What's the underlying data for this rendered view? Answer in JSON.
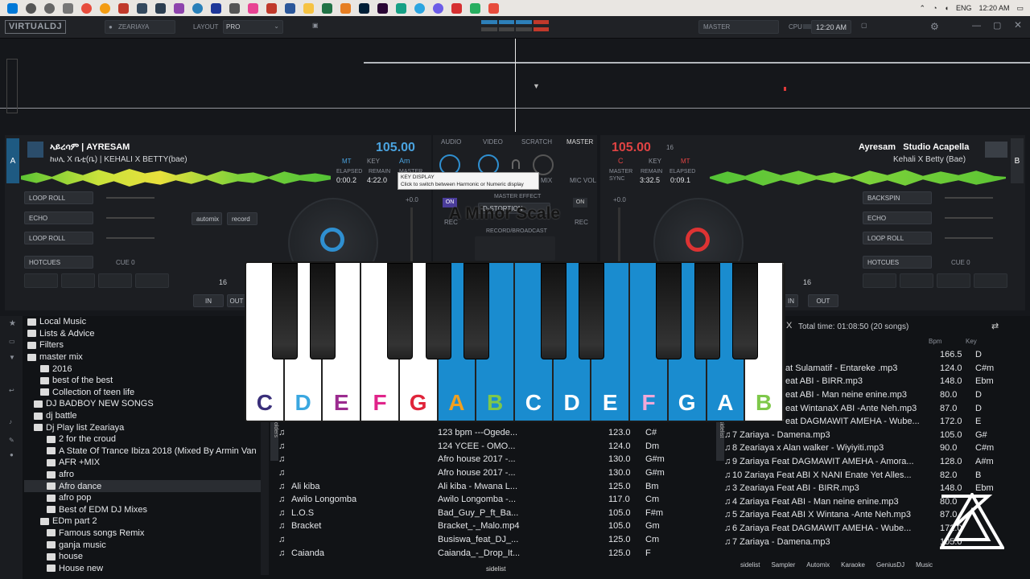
{
  "taskbar": {
    "time": "12:20 AM",
    "lang": "ENG"
  },
  "topbar": {
    "logo": "VIRTUALDJ",
    "user": "ZEARIAYA",
    "layout_label": "LAYOUT",
    "layout_value": "PRO",
    "master": "MASTER",
    "cpu": "CPU",
    "clock": "12:20 AM"
  },
  "deck_left": {
    "title": "ኣይረሳም | AYRESAM",
    "subtitle": "ከሀሊ X ቤቲ(ቤ) | KEHALI X BETTY(bae)",
    "bpm": "105.00",
    "key_label": "KEY",
    "key": "Am",
    "elapsed_label": "ELAPSED",
    "remain_label": "REMAIN",
    "elapsed": "0:00.2",
    "remain": "4:22.0",
    "master_label": "MASTER",
    "letter": "A",
    "pitch": "+0.0",
    "fx": [
      "LOOP ROLL",
      "ECHO",
      "LOOP ROLL"
    ],
    "hotcues": "HOTCUES",
    "cue": "CUE 0",
    "loop": "16",
    "in": "IN",
    "out": "OUT",
    "automix": "automix",
    "record": "record",
    "mt": "MT"
  },
  "deck_right": {
    "title1": "Ayresam",
    "title2": "Studio Acapella",
    "subtitle": "Kehali X Betty (Bae)",
    "bpm": "105.00",
    "key_label": "KEY",
    "key": "C",
    "remain_label": "REMAIN",
    "elapsed_label": "ELAPSED",
    "remain": "3:32.5",
    "elapsed": "0:09.1",
    "letter": "B",
    "pitch": "+0.0",
    "fx": [
      "BACKSPIN",
      "ECHO",
      "LOOP ROLL"
    ],
    "hotcues": "HOTCUES",
    "cue": "CUE 0",
    "loop": "16",
    "in": "IN",
    "out": "OUT",
    "sync": "SYNC",
    "master_label": "MASTER",
    "mt": "MT",
    "track_no": "16"
  },
  "mixer": {
    "tabs": [
      "AUDIO",
      "VIDEO",
      "SCRATCH",
      "MASTER"
    ],
    "tooltip_title": "KEY DISPLAY",
    "tooltip_text": "Click to switch between Harmonic or Numeric display",
    "master_effect": "MASTER EFFECT",
    "effect": "D-STORTION",
    "record": "RECORD/BROADCAST",
    "on": "ON",
    "mic_vol": "MIC VOL",
    "mix": "MIX",
    "rec": "REC",
    "scale": "A Minor Scale"
  },
  "piano": {
    "white_keys": [
      {
        "note": "C",
        "color": "#3a2f7a",
        "fill": "#ffffff"
      },
      {
        "note": "D",
        "color": "#3aa7e0",
        "fill": "#ffffff"
      },
      {
        "note": "E",
        "color": "#9b2b8f",
        "fill": "#ffffff"
      },
      {
        "note": "F",
        "color": "#e0248a",
        "fill": "#ffffff"
      },
      {
        "note": "G",
        "color": "#e0243a",
        "fill": "#ffffff"
      },
      {
        "note": "A",
        "color": "#f0a020",
        "fill": "#1a8ccf"
      },
      {
        "note": "B",
        "color": "#7ec84a",
        "fill": "#1a8ccf"
      },
      {
        "note": "C",
        "color": "#ffffff",
        "fill": "#1a8ccf"
      },
      {
        "note": "D",
        "color": "#ffffff",
        "fill": "#1a8ccf"
      },
      {
        "note": "E",
        "color": "#ffffff",
        "fill": "#1a8ccf"
      },
      {
        "note": "F",
        "color": "#f0a8d8",
        "fill": "#1a8ccf"
      },
      {
        "note": "G",
        "color": "#ffffff",
        "fill": "#1a8ccf"
      },
      {
        "note": "A",
        "color": "#ffffff",
        "fill": "#1a8ccf"
      },
      {
        "note": "B",
        "color": "#7ec84a",
        "fill": "#ffffff"
      }
    ]
  },
  "folders": [
    "Local Music",
    "Lists & Advice",
    "Filters",
    "master mix",
    "2016",
    "best of the best",
    "Collection of teen life",
    "DJ BADBOY NEW SONGS",
    "dj battle",
    "Dj Play list Zeariaya",
    "2 for the croud",
    "A State Of Trance Ibiza 2018 (Mixed By Armin Van",
    "AFR +MIX",
    "afro",
    "Afro dance",
    "afro pop",
    "Best of EDM DJ Mixes",
    "EDm part 2",
    "Famous songs Remix",
    "ganja music",
    "house",
    "House new"
  ],
  "songs": [
    {
      "artist": "",
      "title": "123 bpm ---Ogede...",
      "bpm": "123.0",
      "key": "C#"
    },
    {
      "artist": "",
      "title": "124  YCEE - OMO...",
      "bpm": "124.0",
      "key": "Dm"
    },
    {
      "artist": "",
      "title": "Afro house 2017 -...",
      "bpm": "130.0",
      "key": "G#m"
    },
    {
      "artist": "",
      "title": "Afro house 2017 -...",
      "bpm": "130.0",
      "key": "G#m"
    },
    {
      "artist": "Ali kiba",
      "title": "Ali kiba - Mwana L...",
      "bpm": "125.0",
      "key": "Bm"
    },
    {
      "artist": "Awilo Longomba",
      "title": "Awilo Longomba -...",
      "bpm": "117.0",
      "key": "Cm"
    },
    {
      "artist": "L.O.S",
      "title": "Bad_Guy_P_ft_Ba...",
      "bpm": "105.0",
      "key": "F#m"
    },
    {
      "artist": "Bracket",
      "title": "Bracket_-_Malo.mp4",
      "bpm": "105.0",
      "key": "Gm"
    },
    {
      "artist": "",
      "title": "Busiswa_feat_DJ_...",
      "bpm": "125.0",
      "key": "Cm"
    },
    {
      "artist": "Caianda",
      "title": "Caianda_-_Drop_It...",
      "bpm": "125.0",
      "key": "F"
    }
  ],
  "sidelist": {
    "header": "Total time: 01:08:50 (20 songs)",
    "bpm_col": "Bpm",
    "key_col": "Key",
    "rows": [
      {
        "t": "",
        "b": "166.5",
        "k": "D"
      },
      {
        "t": "at Sulamatif - Entareke .mp3",
        "b": "124.0",
        "k": "C#m"
      },
      {
        "t": "eat ABI - BIRR.mp3",
        "b": "148.0",
        "k": "Ebm"
      },
      {
        "t": "eat ABI - Man neine enine.mp3",
        "b": "80.0",
        "k": "D"
      },
      {
        "t": "eat WintanaX ABI  -Ante Neh.mp3",
        "b": "87.0",
        "k": "D"
      },
      {
        "t": "eat DAGMAWIT AMEHA  - Wube...",
        "b": "172.0",
        "k": "E"
      },
      {
        "t": "7 Zariaya - Damena.mp3",
        "b": "105.0",
        "k": "G#"
      },
      {
        "t": "8 Zeariaya x Alan walker - Wiyiyiti.mp3",
        "b": "90.0",
        "k": "C#m"
      },
      {
        "t": "9 Zariaya Feat DAGMAWIT AMEHA - Amora...",
        "b": "128.0",
        "k": "A#m"
      },
      {
        "t": "10 Zariaya Feat ABI X NANI Enate Yet Alles...",
        "b": "82.0",
        "k": "B"
      },
      {
        "t": "3 Zeariaya Feat ABI - BIRR.mp3",
        "b": "148.0",
        "k": "Ebm"
      },
      {
        "t": "4 Zariaya Feat ABI - Man neine enine.mp3",
        "b": "80.0",
        "k": ""
      },
      {
        "t": "5 Zariaya Feat ABI X Wintana -Ante Neh.mp3",
        "b": "87.0",
        "k": ""
      },
      {
        "t": "6 Zariaya Feat DAGMAWIT AMEHA - Wube...",
        "b": "172.0",
        "k": ""
      },
      {
        "t": "7 Zariaya - Damena.mp3",
        "b": "105.0",
        "k": ""
      }
    ]
  },
  "bottom_tabs": [
    "sidelist",
    "Sampler",
    "Automix",
    "Karaoke",
    "GeniusDJ",
    "Music"
  ],
  "side_label": "folders",
  "side_label_right": "sidelist"
}
